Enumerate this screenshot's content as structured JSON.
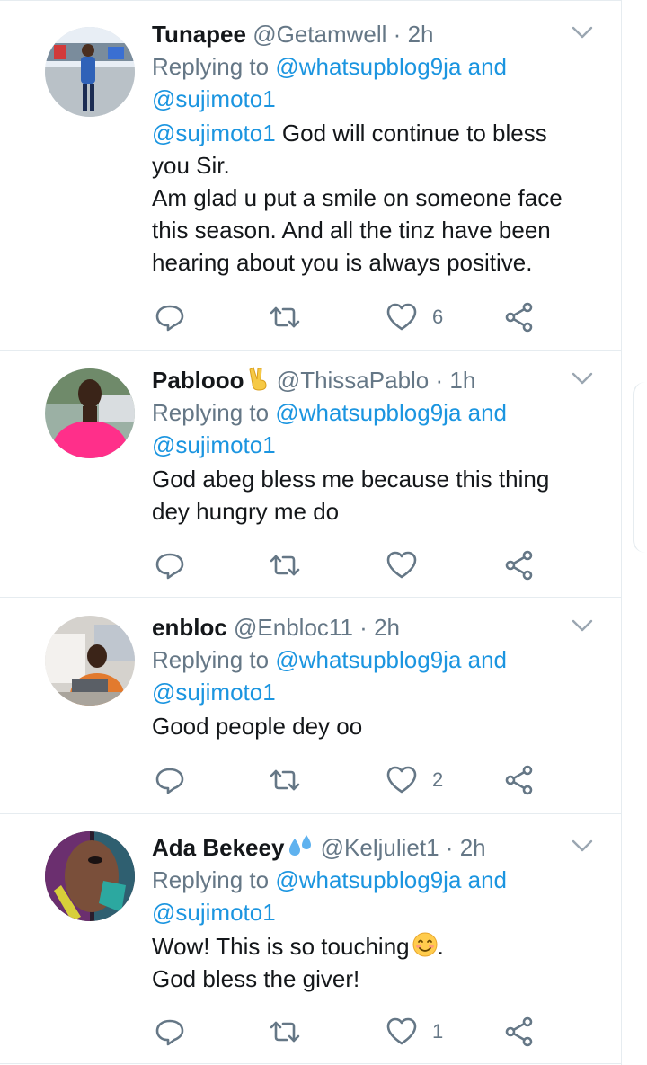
{
  "replying_to_label": "Replying to",
  "replying_and": "and",
  "tweets": [
    {
      "name": "Tunapee",
      "handle": "@Getamwell",
      "dot": "·",
      "time": "2h",
      "reply_mentions": [
        "@whatsupblog9ja",
        "@sujimoto1"
      ],
      "body_mention": "@sujimoto1",
      "body_lines": [
        " God will continue to bless",
        "you Sir.",
        "Am glad u put a smile on someone face",
        "this season. And all the tinz have been",
        "hearing about you is always positive."
      ],
      "likes": "6",
      "emoji": ""
    },
    {
      "name": "Pablooo",
      "handle": "@ThissaPablo",
      "dot": "·",
      "time": "1h",
      "reply_mentions": [
        "@whatsupblog9ja",
        "@sujimoto1"
      ],
      "body_lines": [
        "God abeg bless me because this thing",
        "dey hungry me do"
      ],
      "likes": "",
      "emoji": "victory-hand-emoji"
    },
    {
      "name": "enbloc",
      "handle": "@Enbloc11",
      "dot": "·",
      "time": "2h",
      "reply_mentions": [
        "@whatsupblog9ja",
        "@sujimoto1"
      ],
      "body_lines": [
        "Good people dey oo"
      ],
      "likes": "2",
      "emoji": ""
    },
    {
      "name": "Ada Bekeey",
      "handle": "@Keljuliet1",
      "dot": "·",
      "time": "2h",
      "reply_mentions": [
        "@whatsupblog9ja",
        "@sujimoto1"
      ],
      "body_lines": [
        "Wow! This is so touching",
        "God bless the giver!"
      ],
      "body_line_suffix": ".",
      "likes": "1",
      "emoji": "droplets-emoji"
    }
  ],
  "colors": {
    "link": "#1b95e0",
    "secondary_text": "#657786",
    "primary_text": "#14171a",
    "separator": "#e6ecf0"
  },
  "icons": [
    "reply-icon",
    "retweet-icon",
    "like-icon",
    "share-icon",
    "chevron-down-icon"
  ]
}
